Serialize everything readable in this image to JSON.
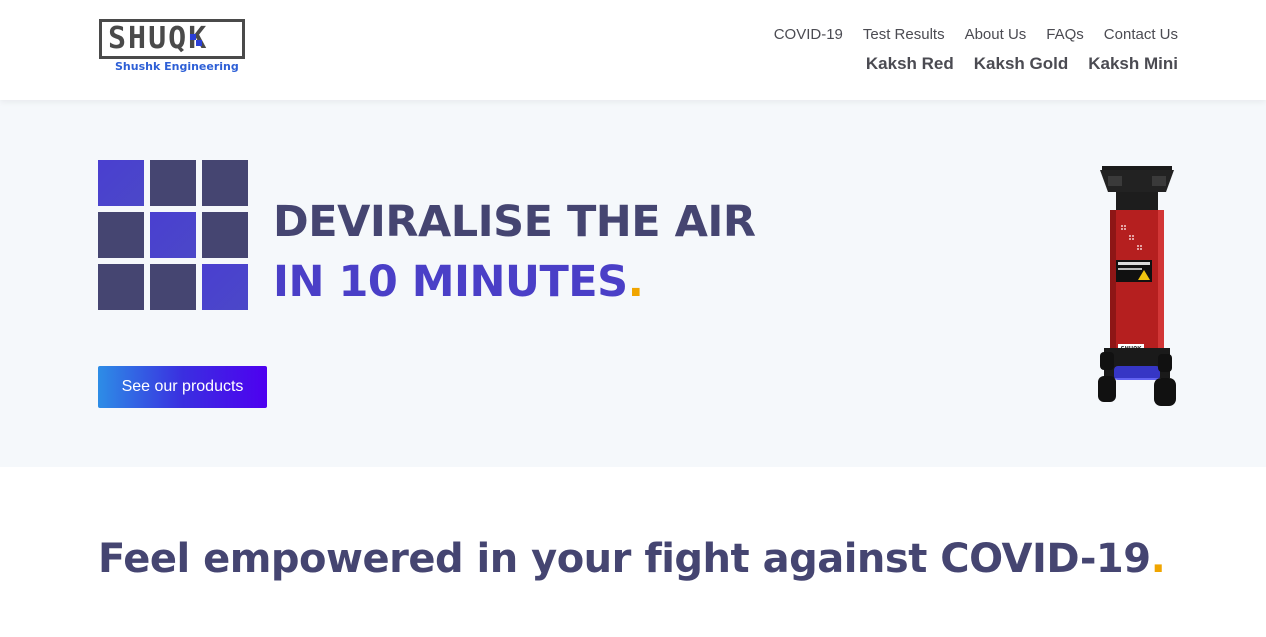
{
  "brand": {
    "logo_text": "SHUQK",
    "tagline": "Shushk Engineering"
  },
  "nav": {
    "top": [
      {
        "label": "COVID-19"
      },
      {
        "label": "Test Results"
      },
      {
        "label": "About Us"
      },
      {
        "label": "FAQs"
      },
      {
        "label": "Contact Us"
      }
    ],
    "products": [
      {
        "label": "Kaksh Red"
      },
      {
        "label": "Kaksh Gold"
      },
      {
        "label": "Kaksh Mini"
      }
    ]
  },
  "hero": {
    "headline_line1": "DEVIRALISE THE AIR",
    "headline_line2": "IN 10 MINUTES",
    "headline_dot": ".",
    "cta_label": "See our products",
    "device_badge": "SHUQK"
  },
  "section": {
    "title": "Feel empowered in your fight against COVID-19",
    "title_dot": "."
  },
  "colors": {
    "navy": "#454571",
    "accent_blue": "#4a3fc7",
    "dot_yellow": "#f0a500",
    "hero_bg": "#f5f8fb",
    "device_red": "#b51f1f"
  }
}
